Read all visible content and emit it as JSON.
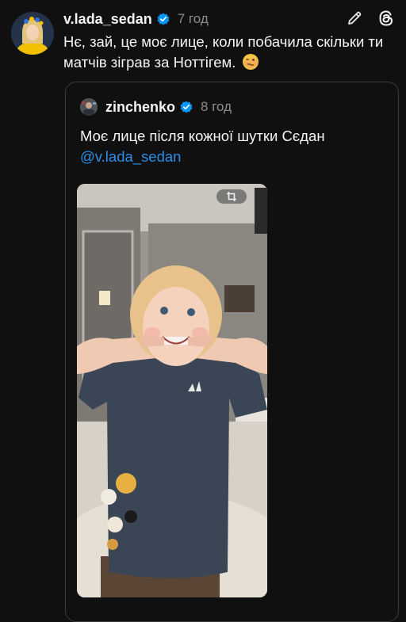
{
  "post": {
    "username": "v.lada_sedan",
    "time": "7 год",
    "text": "Нє, зай, це моє лице, коли побачила скільки ти матчів  зіграв за Ноттігем."
  },
  "quote": {
    "username": "zinchenko",
    "time": "8 год",
    "text": "Моє лице після кожної шутки Сєдан",
    "mention": "@v.lada_sedan"
  },
  "icons": {
    "edit": "pencil-icon",
    "threads": "threads-logo-icon",
    "verified": "verified-badge-icon",
    "emoji": "woozy-face-emoji-icon",
    "crop": "crop-icon"
  },
  "colors": {
    "background": "#101010",
    "verified": "#0095f6",
    "mention": "#2b8ee8",
    "secondary_text": "#8a8d91"
  }
}
